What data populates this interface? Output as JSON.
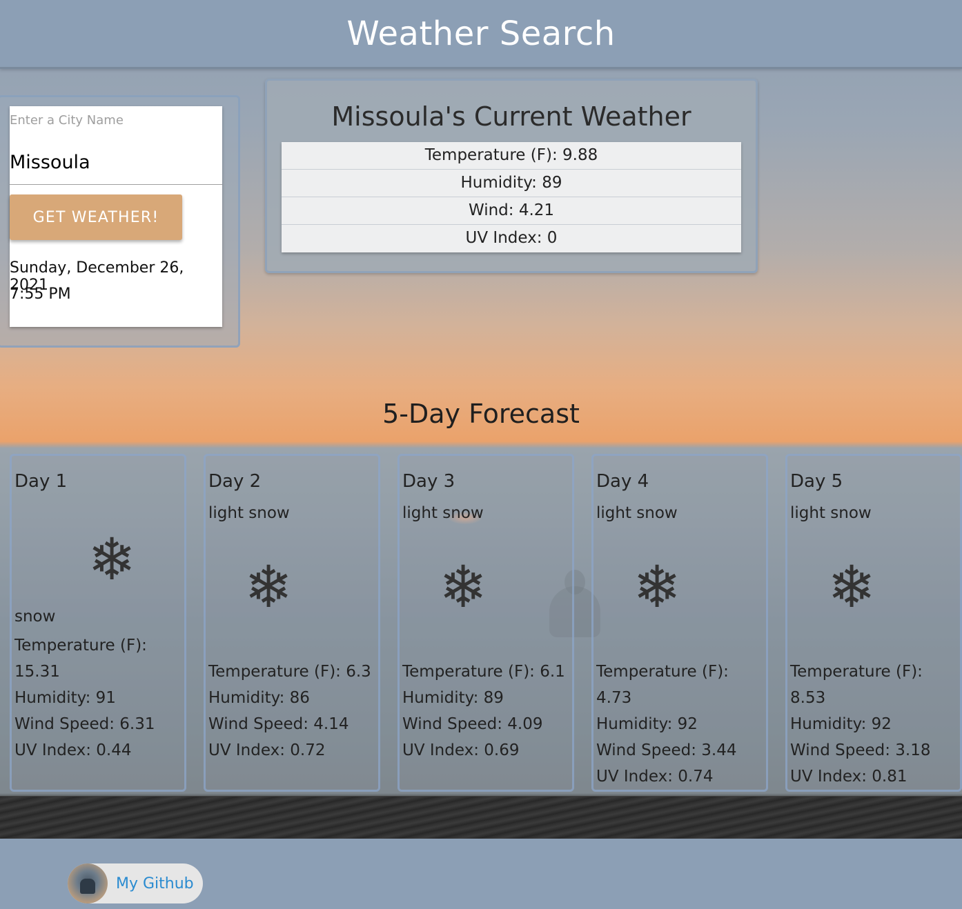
{
  "header": {
    "title": "Weather Search"
  },
  "search": {
    "label": "Enter a City Name",
    "value": "Missoula",
    "button_label": "GET WEATHER!",
    "date": "Sunday, December 26, 2021",
    "time": "7:55 PM"
  },
  "current": {
    "title": "Missoula's Current Weather",
    "rows": [
      "Temperature (F): 9.88",
      "Humidity: 89",
      "Wind: 4.21",
      "UV Index: 0"
    ]
  },
  "forecast": {
    "title": "5-Day Forecast",
    "days": [
      {
        "name": "Day 1",
        "description": "snow",
        "icon": "snowflake-icon",
        "temperature": "Temperature (F): 15.31",
        "humidity": "Humidity: 91",
        "wind": "Wind Speed: 6.31",
        "uv": "UV Index: 0.44"
      },
      {
        "name": "Day 2",
        "description": "light snow",
        "icon": "snowflake-icon",
        "temperature": "Temperature (F): 6.3",
        "humidity": "Humidity: 86",
        "wind": "Wind Speed: 4.14",
        "uv": "UV Index: 0.72"
      },
      {
        "name": "Day 3",
        "description": "light snow",
        "icon": "snowflake-icon",
        "temperature": "Temperature (F): 6.1",
        "humidity": "Humidity: 89",
        "wind": "Wind Speed: 4.09",
        "uv": "UV Index: 0.69"
      },
      {
        "name": "Day 4",
        "description": "light snow",
        "icon": "snowflake-icon",
        "temperature": "Temperature (F): 4.73",
        "humidity": "Humidity: 92",
        "wind": "Wind Speed: 3.44",
        "uv": "UV Index: 0.74"
      },
      {
        "name": "Day 5",
        "description": "light snow",
        "icon": "snowflake-icon",
        "temperature": "Temperature (F): 8.53",
        "humidity": "Humidity: 92",
        "wind": "Wind Speed: 3.18",
        "uv": "UV Index: 0.81"
      }
    ]
  },
  "footer": {
    "github_label": "My Github"
  },
  "colors": {
    "header_bg": "#8c9fb5",
    "button_bg": "#d8a878",
    "link": "#2a8bd0"
  }
}
